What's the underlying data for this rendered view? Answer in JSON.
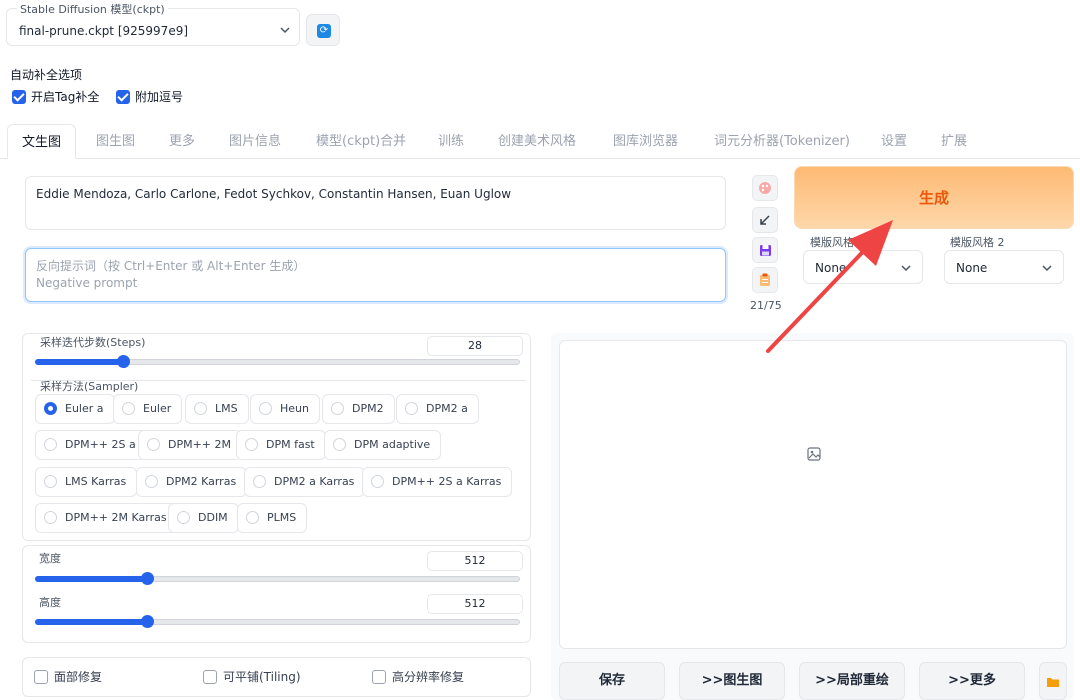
{
  "model": {
    "label": "Stable Diffusion 模型(ckpt)",
    "value": "final-prune.ckpt [925997e9]"
  },
  "autocomplete": {
    "title": "自动补全选项",
    "options": [
      {
        "label": "开启Tag补全",
        "checked": true
      },
      {
        "label": "附加逗号",
        "checked": true
      }
    ]
  },
  "tabs": [
    "文生图",
    "图生图",
    "更多",
    "图片信息",
    "模型(ckpt)合并",
    "训练",
    "创建美术风格",
    "图库浏览器",
    "词元分析器(Tokenizer)",
    "设置",
    "扩展"
  ],
  "prompt": {
    "positive": "Eddie Mendoza, Carlo Carlone, Fedot Sychkov, Constantin Hansen, Euan Uglow",
    "negative_placeholder_1": "反向提示词（按 Ctrl+Enter 或 Alt+Enter 生成）",
    "negative_placeholder_2": "Negative prompt",
    "token_count": "21/75"
  },
  "tools": [
    "palette-icon",
    "arrow-diagonal-icon",
    "save-icon",
    "clipboard-icon"
  ],
  "generate_label": "生成",
  "styles": [
    {
      "label": "模版风格 1",
      "value": "None"
    },
    {
      "label": "模版风格 2",
      "value": "None"
    }
  ],
  "steps": {
    "label": "采样迭代步数(Steps)",
    "value": "28",
    "fraction": 0.18
  },
  "sampler": {
    "label": "采样方法(Sampler)",
    "options": [
      "Euler a",
      "Euler",
      "LMS",
      "Heun",
      "DPM2",
      "DPM2 a",
      "DPM++ 2S a",
      "DPM++ 2M",
      "DPM fast",
      "DPM adaptive",
      "LMS Karras",
      "DPM2 Karras",
      "DPM2 a Karras",
      "DPM++ 2S a Karras",
      "DPM++ 2M Karras",
      "DDIM",
      "PLMS"
    ],
    "selected": "Euler a"
  },
  "width": {
    "label": "宽度",
    "value": "512",
    "fraction": 0.23
  },
  "height": {
    "label": "高度",
    "value": "512",
    "fraction": 0.23
  },
  "checkboxes": [
    {
      "label": "面部修复",
      "checked": false
    },
    {
      "label": "可平铺(Tiling)",
      "checked": false
    },
    {
      "label": "高分辨率修复",
      "checked": false
    }
  ],
  "actions": [
    ">>图生图",
    ">>局部重绘",
    ">>更多"
  ],
  "save_label": "保存",
  "colors": {
    "accent": "#2563eb",
    "generate": "#ea580c",
    "annotation_arrow": "#ef4444"
  }
}
